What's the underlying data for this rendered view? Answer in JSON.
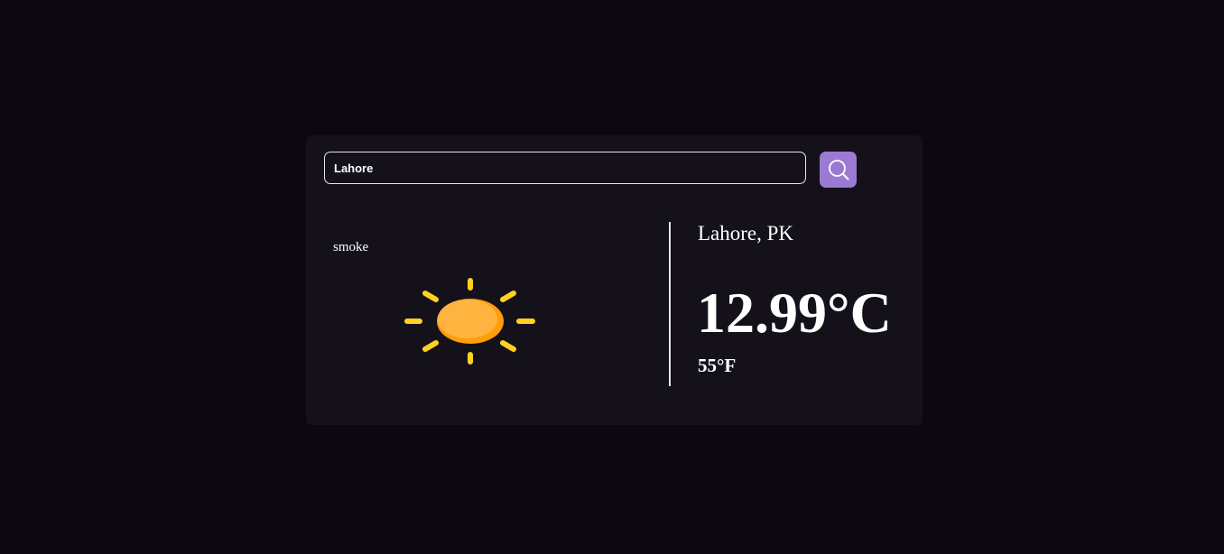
{
  "search": {
    "value": "Lahore",
    "icon": "search-icon"
  },
  "weather": {
    "condition": "smoke",
    "icon": "sun-icon",
    "location": "Lahore, PK",
    "temp_c": "12.99°C",
    "temp_f": "55°F"
  },
  "colors": {
    "page_bg": "#0c0812",
    "card_bg": "#15111b",
    "accent": "#9b7ad4",
    "sun_core": "#ffad33",
    "sun_rays": "#ffd21f"
  }
}
